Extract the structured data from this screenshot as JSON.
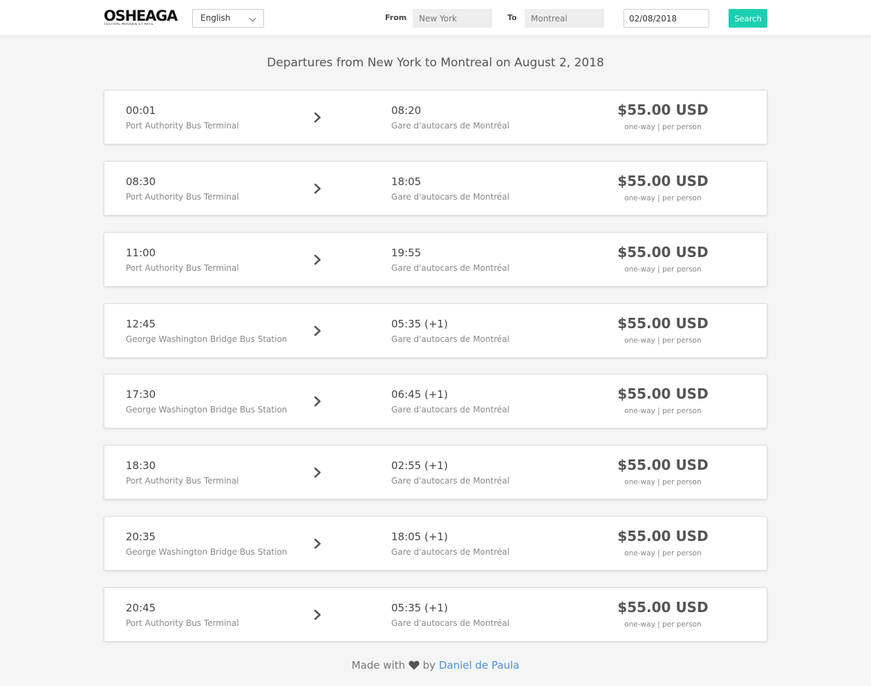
{
  "brand": {
    "logo_text": "OSHEAGA",
    "logo_subtext": "FESTIVAL MUSIQUE ET ARTS"
  },
  "search": {
    "language": "English",
    "from_label": "From",
    "from_value": "New York",
    "to_label": "To",
    "to_value": "Montreal",
    "date_value": "02/08/2018",
    "button_label": "Search"
  },
  "heading": "Departures from New York to Montreal on August 2, 2018",
  "departures": [
    {
      "dep_time": "00:01",
      "dep_station": "Port Authority Bus Terminal",
      "arr_time": "08:20",
      "arr_station": "Gare d'autocars de Montréal",
      "price": "$55.00 USD",
      "price_note": "one-way | per person"
    },
    {
      "dep_time": "08:30",
      "dep_station": "Port Authority Bus Terminal",
      "arr_time": "18:05",
      "arr_station": "Gare d'autocars de Montréal",
      "price": "$55.00 USD",
      "price_note": "one-way | per person"
    },
    {
      "dep_time": "11:00",
      "dep_station": "Port Authority Bus Terminal",
      "arr_time": "19:55",
      "arr_station": "Gare d'autocars de Montréal",
      "price": "$55.00 USD",
      "price_note": "one-way | per person"
    },
    {
      "dep_time": "12:45",
      "dep_station": "George Washington Bridge Bus Station",
      "arr_time": "05:35 (+1)",
      "arr_station": "Gare d'autocars de Montréal",
      "price": "$55.00 USD",
      "price_note": "one-way | per person"
    },
    {
      "dep_time": "17:30",
      "dep_station": "George Washington Bridge Bus Station",
      "arr_time": "06:45 (+1)",
      "arr_station": "Gare d'autocars de Montréal",
      "price": "$55.00 USD",
      "price_note": "one-way | per person"
    },
    {
      "dep_time": "18:30",
      "dep_station": "Port Authority Bus Terminal",
      "arr_time": "02:55 (+1)",
      "arr_station": "Gare d'autocars de Montréal",
      "price": "$55.00 USD",
      "price_note": "one-way | per person"
    },
    {
      "dep_time": "20:35",
      "dep_station": "George Washington Bridge Bus Station",
      "arr_time": "18:05 (+1)",
      "arr_station": "Gare d'autocars de Montréal",
      "price": "$55.00 USD",
      "price_note": "one-way | per person"
    },
    {
      "dep_time": "20:45",
      "dep_station": "Port Authority Bus Terminal",
      "arr_time": "05:35 (+1)",
      "arr_station": "Gare d'autocars de Montréal",
      "price": "$55.00 USD",
      "price_note": "one-way | per person"
    }
  ],
  "footer": {
    "made_with": "Made with",
    "by": "by",
    "author": "Daniel de Paula"
  },
  "colors": {
    "accent": "#1ccfb0",
    "link": "#4a90d9",
    "background": "#f5f5f5"
  },
  "icons": {
    "arrow": "chevron-right-icon",
    "heart": "heart-icon",
    "dropdown": "chevron-down-icon"
  }
}
